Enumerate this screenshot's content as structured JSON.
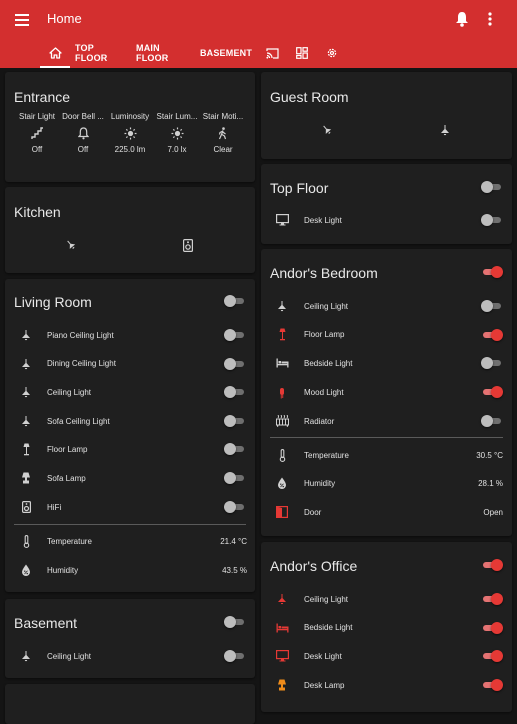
{
  "header": {
    "title": "Home",
    "tabs": [
      "TOP FLOOR",
      "MAIN FLOOR",
      "BASEMENT"
    ]
  },
  "colors": {
    "accent": "#d32f2f",
    "toggle_on": "#e53935",
    "card_bg": "#1f1f1f",
    "page_bg": "#141414"
  },
  "entrance": {
    "title": "Entrance",
    "items": [
      {
        "name": "Stair Light",
        "icon": "stairs-icon",
        "value": "Off"
      },
      {
        "name": "Door Bell ...",
        "icon": "bell-icon",
        "value": "Off"
      },
      {
        "name": "Luminosity",
        "icon": "brightness-icon",
        "value": "225.0 lm"
      },
      {
        "name": "Stair Lum...",
        "icon": "brightness-icon",
        "value": "7.0 lx"
      },
      {
        "name": "Stair Moti...",
        "icon": "walk-icon",
        "value": "Clear"
      }
    ]
  },
  "kitchen": {
    "title": "Kitchen"
  },
  "living_room": {
    "title": "Living Room",
    "master_on": false,
    "rows": [
      {
        "label": "Piano Ceiling Light",
        "icon": "ceiling-light-icon",
        "on": false
      },
      {
        "label": "Dining Ceiling Light",
        "icon": "ceiling-light-icon",
        "on": false
      },
      {
        "label": "Ceiling Light",
        "icon": "ceiling-light-icon",
        "on": false
      },
      {
        "label": "Sofa Ceiling Light",
        "icon": "ceiling-light-icon",
        "on": false
      },
      {
        "label": "Floor Lamp",
        "icon": "floor-lamp-icon",
        "on": false
      },
      {
        "label": "Sofa Lamp",
        "icon": "lamp-icon",
        "on": false
      },
      {
        "label": "HiFi",
        "icon": "speaker-icon",
        "on": false
      }
    ],
    "sensors": [
      {
        "label": "Temperature",
        "icon": "thermometer-icon",
        "value": "21.4 °C"
      },
      {
        "label": "Humidity",
        "icon": "water-percent-icon",
        "value": "43.5 %"
      }
    ]
  },
  "basement": {
    "title": "Basement",
    "master_on": false,
    "rows": [
      {
        "label": "Ceiling Light",
        "icon": "ceiling-light-icon",
        "on": false
      }
    ]
  },
  "guest_room": {
    "title": "Guest Room"
  },
  "top_floor": {
    "title": "Top Floor",
    "master_on": false,
    "rows": [
      {
        "label": "Desk Light",
        "icon": "monitor-icon",
        "on": false
      }
    ]
  },
  "andors_bedroom": {
    "title": "Andor's Bedroom",
    "master_on": true,
    "rows": [
      {
        "label": "Ceiling Light",
        "icon": "ceiling-light-icon",
        "on": false
      },
      {
        "label": "Floor Lamp",
        "icon": "floor-lamp-icon",
        "on": true
      },
      {
        "label": "Bedside Light",
        "icon": "bed-icon",
        "on": false
      },
      {
        "label": "Mood Light",
        "icon": "led-strip-icon",
        "on": true
      },
      {
        "label": "Radiator",
        "icon": "radiator-icon",
        "on": false
      }
    ],
    "sensors": [
      {
        "label": "Temperature",
        "icon": "thermometer-icon",
        "value": "30.5 °C"
      },
      {
        "label": "Humidity",
        "icon": "water-percent-icon",
        "value": "28.1 %"
      },
      {
        "label": "Door",
        "icon": "door-open-icon",
        "value": "Open"
      }
    ]
  },
  "andors_office": {
    "title": "Andor's Office",
    "master_on": true,
    "rows": [
      {
        "label": "Ceiling Light",
        "icon": "ceiling-light-icon",
        "on": true
      },
      {
        "label": "Bedside Light",
        "icon": "bed-icon",
        "on": true
      },
      {
        "label": "Desk Light",
        "icon": "monitor-icon",
        "on": true
      },
      {
        "label": "Desk Lamp",
        "icon": "lamp-icon",
        "on": true
      }
    ]
  }
}
